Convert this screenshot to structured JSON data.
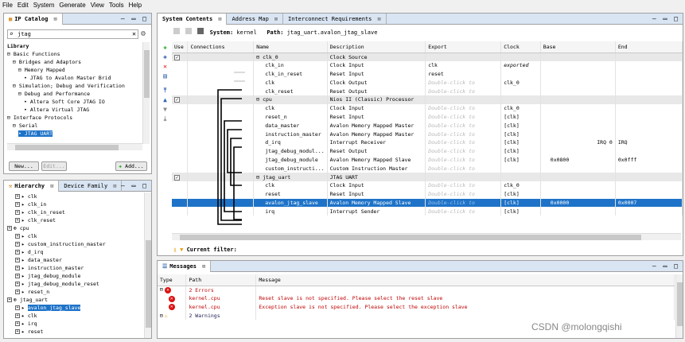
{
  "menu": [
    "File",
    "Edit",
    "System",
    "Generate",
    "View",
    "Tools",
    "Help"
  ],
  "ip_catalog": {
    "tab_label": "IP Catalog",
    "search_value": "jtag",
    "tree": [
      {
        "indent": 0,
        "label": "Library",
        "bold": true
      },
      {
        "indent": 0,
        "label": "⊟ Basic Functions"
      },
      {
        "indent": 1,
        "label": "⊟ Bridges and Adaptors"
      },
      {
        "indent": 2,
        "label": "⊟ Memory Mapped"
      },
      {
        "indent": 3,
        "label": "• JTAG to Avalon Master Brid"
      },
      {
        "indent": 1,
        "label": "⊟ Simulation; Debug and Verification"
      },
      {
        "indent": 2,
        "label": "⊟ Debug and Performance"
      },
      {
        "indent": 3,
        "label": "• Altera Soft Core JTAG IO"
      },
      {
        "indent": 3,
        "label": "• Altera Virtual JTAG"
      },
      {
        "indent": 0,
        "label": "⊟ Interface Protocols"
      },
      {
        "indent": 1,
        "label": "⊟ Serial"
      },
      {
        "indent": 2,
        "label": "• JTAG UART",
        "selected": true
      }
    ],
    "new_label": "New...",
    "edit_label": "Edit...",
    "add_label": "Add..."
  },
  "hierarchy": {
    "tab_label": "Hierarchy",
    "tab2_label": "Device Family",
    "rows": [
      {
        "indent": 1,
        "label": "clk"
      },
      {
        "indent": 1,
        "label": "clk_in"
      },
      {
        "indent": 1,
        "label": "clk_in_reset"
      },
      {
        "indent": 1,
        "label": "clk_reset"
      },
      {
        "indent": 0,
        "label": "cpu"
      },
      {
        "indent": 1,
        "label": "clk"
      },
      {
        "indent": 1,
        "label": "custom_instruction_master"
      },
      {
        "indent": 1,
        "label": "d_irq"
      },
      {
        "indent": 1,
        "label": "data_master"
      },
      {
        "indent": 1,
        "label": "instruction_master"
      },
      {
        "indent": 1,
        "label": "jtag_debug_module"
      },
      {
        "indent": 1,
        "label": "jtag_debug_module_reset"
      },
      {
        "indent": 1,
        "label": "reset_n"
      },
      {
        "indent": 0,
        "label": "jtag_uart"
      },
      {
        "indent": 1,
        "label": "avalon_jtag_slave",
        "selected": true
      },
      {
        "indent": 1,
        "label": "clk"
      },
      {
        "indent": 1,
        "label": "irq"
      },
      {
        "indent": 1,
        "label": "reset"
      }
    ]
  },
  "system": {
    "tabs": [
      "System Contents",
      "Address Map",
      "Interconnect Requirements"
    ],
    "system_label": "System:",
    "system_name": "kernel",
    "path_label": "Path:",
    "path_value": "jtag_uart.avalon_jtag_slave",
    "columns": [
      "Use",
      "Connections",
      "Name",
      "Description",
      "Export",
      "Clock",
      "Base",
      "End"
    ],
    "rows": [
      {
        "type": "comp",
        "use": true,
        "name": "⊟ clk_0",
        "desc": "Clock Source",
        "export": "",
        "clock": "",
        "base": "",
        "end": ""
      },
      {
        "type": "port",
        "name": "clk_in",
        "desc": "Clock Input",
        "export": "clk",
        "clock": "exported",
        "base": "",
        "end": ""
      },
      {
        "type": "port",
        "name": "clk_in_reset",
        "desc": "Reset Input",
        "export": "reset",
        "clock": "",
        "base": "",
        "end": ""
      },
      {
        "type": "port",
        "name": "clk",
        "desc": "Clock Output",
        "export": "Double-click to",
        "clock": "clk_0",
        "base": "",
        "end": ""
      },
      {
        "type": "port",
        "name": "clk_reset",
        "desc": "Reset Output",
        "export": "Double-click to",
        "clock": "",
        "base": "",
        "end": ""
      },
      {
        "type": "comp",
        "use": true,
        "name": "⊟ cpu",
        "desc": "Nios II (Classic) Processor",
        "export": "",
        "clock": "",
        "base": "",
        "end": ""
      },
      {
        "type": "port",
        "name": "clk",
        "desc": "Clock Input",
        "export": "Double-click to",
        "clock": "clk_0",
        "base": "",
        "end": ""
      },
      {
        "type": "port",
        "name": "reset_n",
        "desc": "Reset Input",
        "export": "Double-click to",
        "clock": "[clk]",
        "base": "",
        "end": ""
      },
      {
        "type": "port",
        "name": "data_master",
        "desc": "Avalon Memory Mapped Master",
        "export": "Double-click to",
        "clock": "[clk]",
        "base": "",
        "end": ""
      },
      {
        "type": "port",
        "name": "instruction_master",
        "desc": "Avalon Memory Mapped Master",
        "export": "Double-click to",
        "clock": "[clk]",
        "base": "",
        "end": ""
      },
      {
        "type": "port",
        "name": "d_irq",
        "desc": "Interrupt Receiver",
        "export": "Double-click to",
        "clock": "[clk]",
        "base": "IRQ 0",
        "end": "IRQ"
      },
      {
        "type": "port",
        "name": "jtag_debug_modul...",
        "desc": "Reset Output",
        "export": "Double-click to",
        "clock": "[clk]",
        "base": "",
        "end": ""
      },
      {
        "type": "port",
        "name": "jtag_debug_module",
        "desc": "Avalon Memory Mapped Slave",
        "export": "Double-click to",
        "clock": "[clk]",
        "base": "0x0800",
        "end": "0x0fff"
      },
      {
        "type": "port",
        "name": "custom_instructi...",
        "desc": "Custom Instruction Master",
        "export": "Double-click to",
        "clock": "",
        "base": "",
        "end": ""
      },
      {
        "type": "comp",
        "use": true,
        "name": "⊟ jtag_uart",
        "desc": "JTAG UART",
        "export": "",
        "clock": "",
        "base": "",
        "end": ""
      },
      {
        "type": "port",
        "name": "clk",
        "desc": "Clock Input",
        "export": "Double-click to",
        "clock": "clk_0",
        "base": "",
        "end": ""
      },
      {
        "type": "port",
        "name": "reset",
        "desc": "Reset Input",
        "export": "Double-click to",
        "clock": "[clk]",
        "base": "",
        "end": ""
      },
      {
        "type": "sel",
        "name": "avalon_jtag_slave",
        "desc": "Avalon Memory Mapped Slave",
        "export": "Double-click to",
        "clock": "[clk]",
        "base": "0x0000",
        "end": "0x0007"
      },
      {
        "type": "port",
        "name": "irq",
        "desc": "Interrupt Sender",
        "export": "Double-click to",
        "clock": "[clk]",
        "base": "",
        "end": ""
      }
    ],
    "filter_label": "Current filter:"
  },
  "messages": {
    "tab_label": "Messages",
    "columns": [
      "Type",
      "Path",
      "Message"
    ],
    "rows": [
      {
        "kind": "group",
        "type": "⊟",
        "path": "2 Errors",
        "message": "",
        "err": true
      },
      {
        "kind": "err",
        "type": "",
        "path": "kernel.cpu",
        "message": "Reset slave is not specified. Please select the reset slave"
      },
      {
        "kind": "err",
        "type": "",
        "path": "kernel.cpu",
        "message": "Exception slave is not specified. Please select the exception slave"
      },
      {
        "kind": "group",
        "type": "⊟",
        "path": "2 Warnings",
        "message": "",
        "err": false
      }
    ]
  },
  "watermark": "CSDN @molongqishi"
}
